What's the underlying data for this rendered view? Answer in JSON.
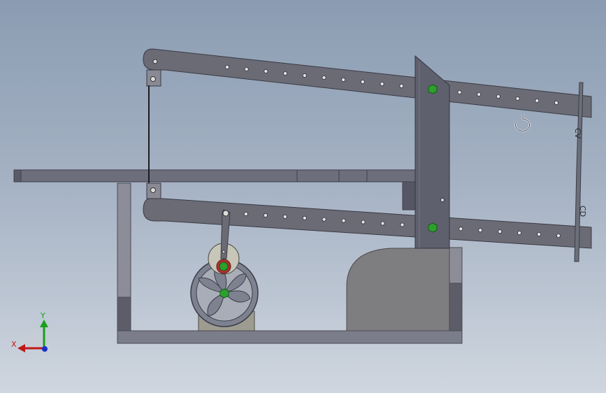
{
  "viewport": {
    "background_top": "#8b9cb2",
    "background_bottom": "#cfd6df"
  },
  "model": {
    "part_colors": {
      "arm": "#6c6c76",
      "frame": "#7f8090",
      "frame_dark": "#5e5f6b",
      "housing": "#7e7e80",
      "fastener": "#2da02d",
      "blade": "#6a6f7a"
    },
    "labels": {
      "blade_upper_marking": "CV",
      "blade_lower_marking": "CD"
    }
  },
  "triad": {
    "x_label": "X",
    "y_label": "Y",
    "x_color": "#c01818",
    "y_color": "#18a018",
    "z_color": "#1830c8"
  }
}
